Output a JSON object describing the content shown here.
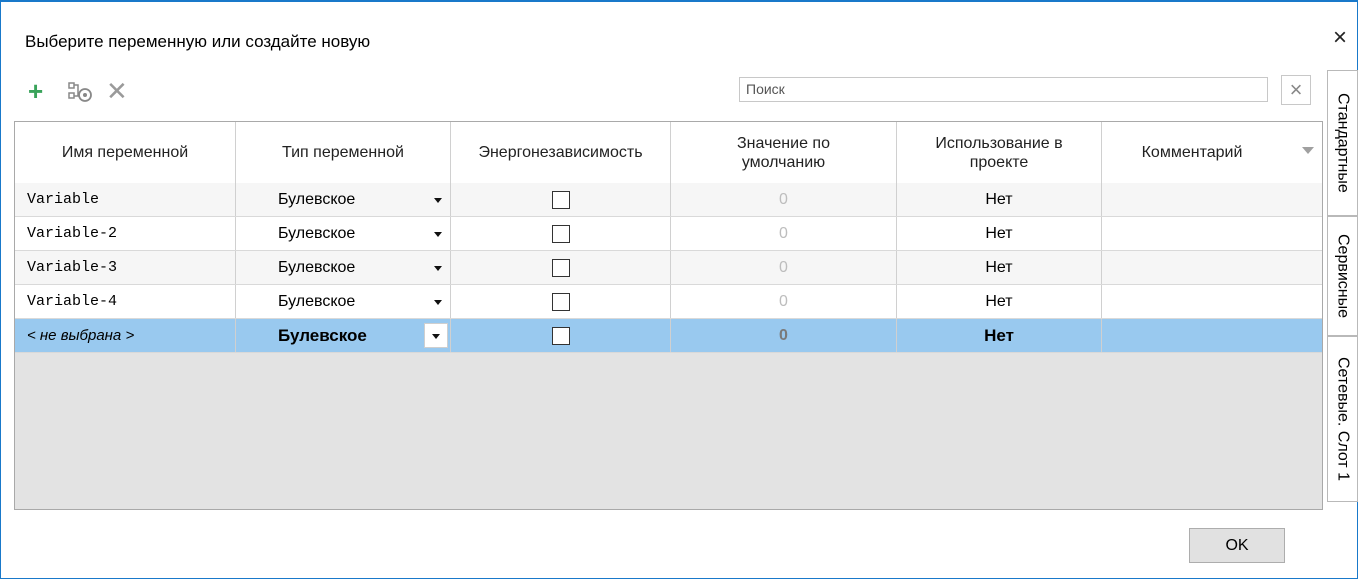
{
  "window": {
    "title": "Выберите переменную или создайте новую",
    "close_label": "×"
  },
  "toolbar": {
    "add_icon": "plus-icon",
    "link_icon": "link-variables-icon",
    "delete_icon": "delete-icon"
  },
  "search": {
    "placeholder": "Поиск",
    "value": "",
    "clear_label": "×"
  },
  "table": {
    "headers": [
      "Имя переменной",
      "Тип переменной",
      "Энергонезависимость",
      "Значение по умолчанию",
      "Использование в проекте",
      "Комментарий"
    ],
    "rows": [
      {
        "name": "Variable",
        "type": "Булевское",
        "retain": false,
        "default": "0",
        "usage": "Нет",
        "comment": ""
      },
      {
        "name": "Variable-2",
        "type": "Булевское",
        "retain": false,
        "default": "0",
        "usage": "Нет",
        "comment": ""
      },
      {
        "name": "Variable-3",
        "type": "Булевское",
        "retain": false,
        "default": "0",
        "usage": "Нет",
        "comment": ""
      },
      {
        "name": "Variable-4",
        "type": "Булевское",
        "retain": false,
        "default": "0",
        "usage": "Нет",
        "comment": ""
      },
      {
        "name": "< не выбрана >",
        "type": "Булевское",
        "retain": false,
        "default": "0",
        "usage": "Нет",
        "comment": "",
        "selected": true
      }
    ]
  },
  "side_tabs": [
    "Стандартные",
    "Сервисные",
    "Сетевые. Слот 1"
  ],
  "ok_label": "OK",
  "colors": {
    "accent": "#1979ca",
    "selected_row": "#99c9ef",
    "add_icon": "#3aa35b"
  }
}
